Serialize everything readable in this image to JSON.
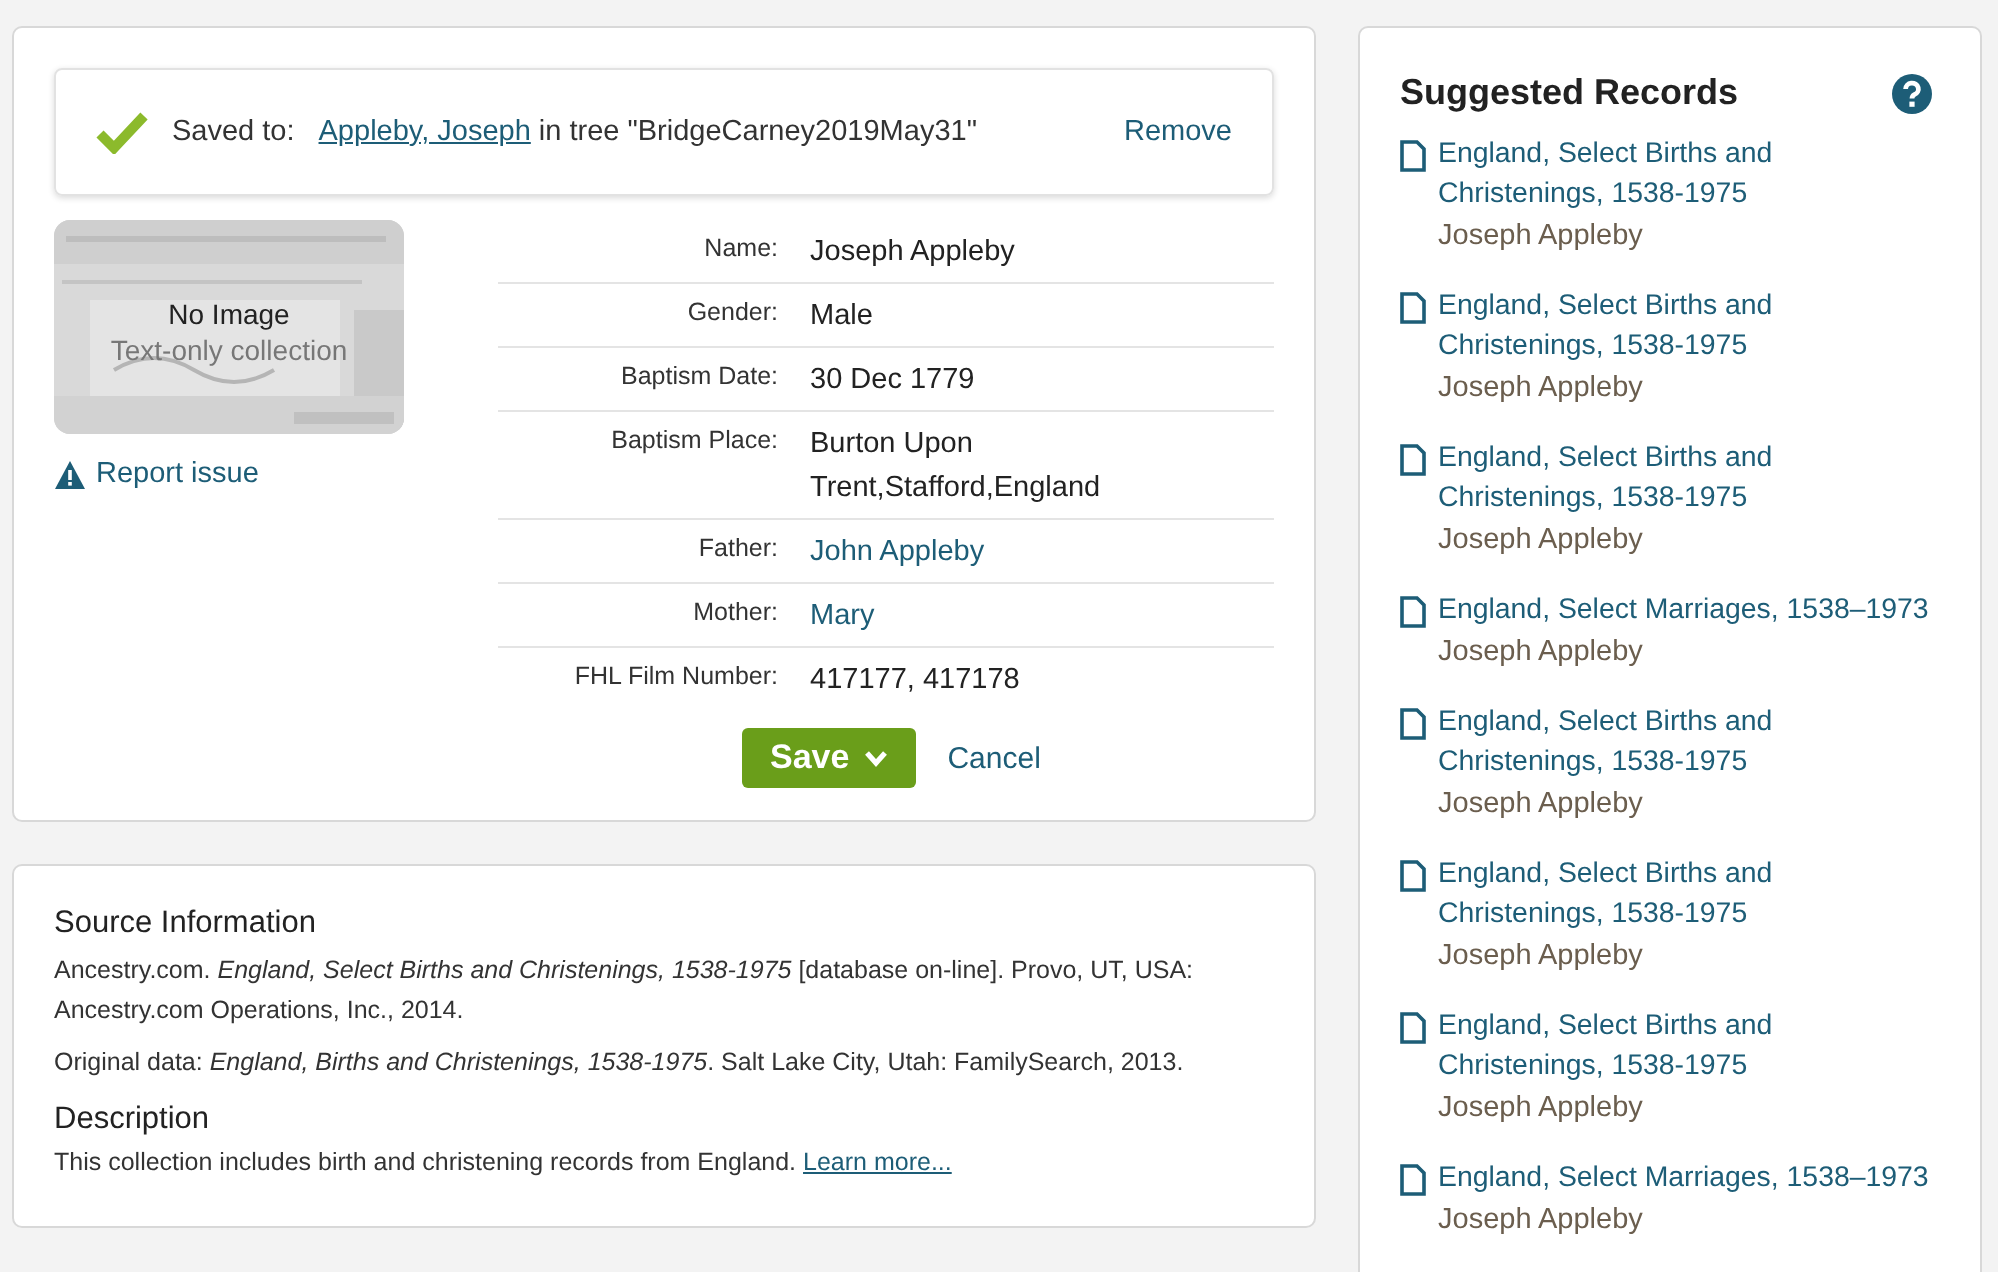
{
  "saved_banner": {
    "label": "Saved to:",
    "person_link": "Appleby, Joseph",
    "tree_text": "in tree \"BridgeCarney2019May31\"",
    "remove": "Remove"
  },
  "image_placeholder": {
    "kind": "picture",
    "title": "No Image",
    "subtitle": "Text-only collection"
  },
  "report_issue": "Report issue",
  "fields": [
    {
      "label": "Name:",
      "value": "Joseph Appleby",
      "kind": "text"
    },
    {
      "label": "Gender:",
      "value": "Male",
      "kind": "text"
    },
    {
      "label": "Baptism Date:",
      "value": "30 Dec 1779",
      "kind": "text"
    },
    {
      "label": "Baptism Place:",
      "value": "Burton Upon Trent,Stafford,England",
      "kind": "text"
    },
    {
      "label": "Father:",
      "value": "John Appleby",
      "kind": "link"
    },
    {
      "label": "Mother:",
      "value": "Mary",
      "kind": "link"
    },
    {
      "label": "FHL Film Number:",
      "value": "417177, 417178",
      "kind": "text"
    }
  ],
  "actions": {
    "save": "Save",
    "cancel": "Cancel"
  },
  "source": {
    "heading": "Source Information",
    "citation": "Ancestry.com. *England, Select Births and Christenings, 1538-1975* [database on-line]. Provo, UT, USA: Ancestry.com Operations, Inc., 2014.",
    "original_data": "Original data: *England, Births and Christenings, 1538-1975*. Salt Lake City, Utah: FamilySearch, 2013.",
    "description_heading": "Description",
    "description": "This collection includes birth and christening records from England.",
    "learn_more": "Learn more..."
  },
  "suggested": {
    "title": "Suggested Records",
    "records": [
      {
        "title": "England, Select Births and Christenings, 1538-1975",
        "person": "Joseph Appleby"
      },
      {
        "title": "England, Select Births and Christenings, 1538-1975",
        "person": "Joseph Appleby"
      },
      {
        "title": "England, Select Births and Christenings, 1538-1975",
        "person": "Joseph Appleby"
      },
      {
        "title": "England, Select Marriages, 1538–1973",
        "person": "Joseph Appleby"
      },
      {
        "title": "England, Select Births and Christenings, 1538-1975",
        "person": "Joseph Appleby"
      },
      {
        "title": "England, Select Births and Christenings, 1538-1975",
        "person": "Joseph Appleby"
      },
      {
        "title": "England, Select Births and Christenings, 1538-1975",
        "person": "Joseph Appleby"
      },
      {
        "title": "England, Select Marriages, 1538–1973",
        "person": "Joseph Appleby"
      }
    ]
  }
}
